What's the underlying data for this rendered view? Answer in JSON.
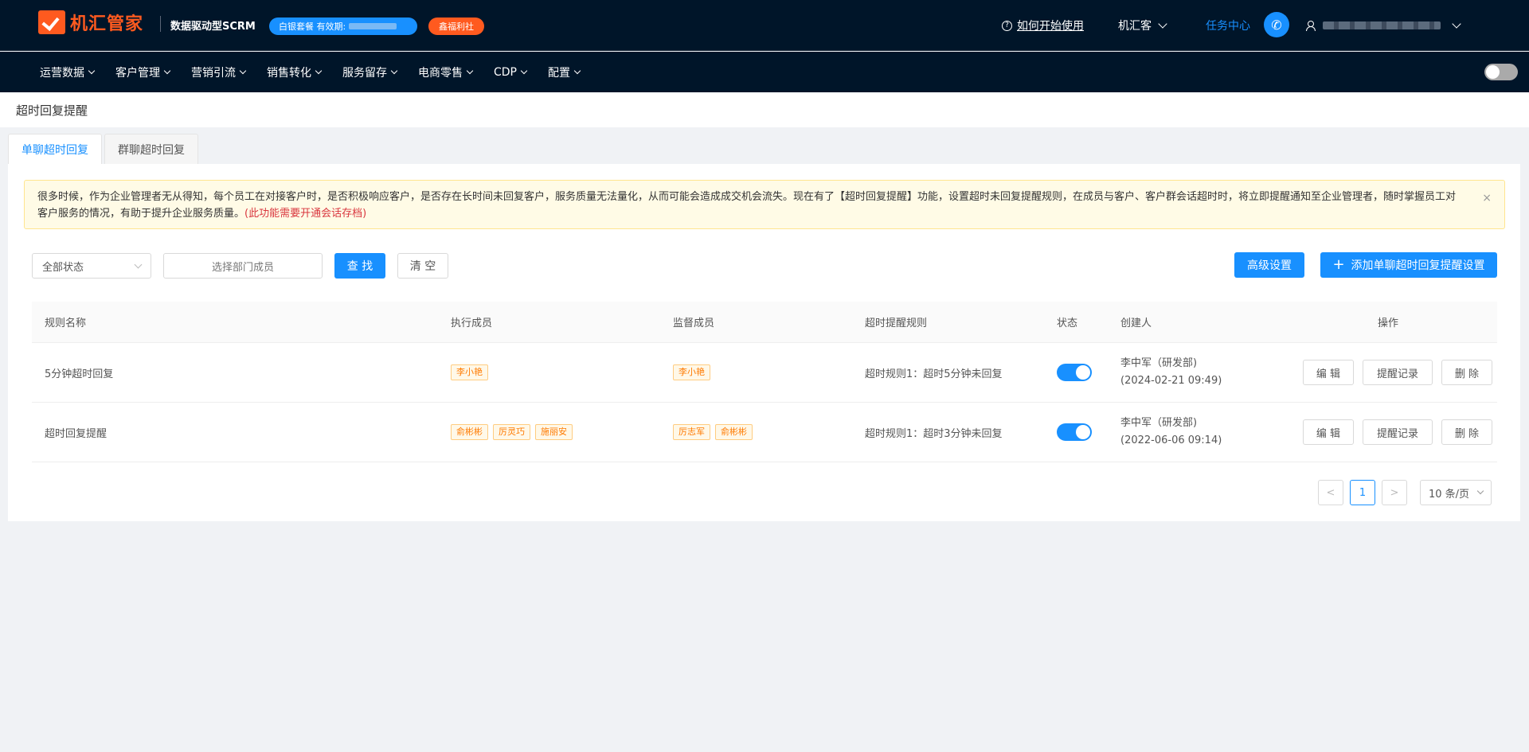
{
  "app": {
    "logo_text": "机汇管家",
    "slogan": "数据驱动型SCRM",
    "package_label": "白银套餐 有效期:",
    "welfare_label": "鑫福利社",
    "help_label": "如何开始使用",
    "org_label": "机汇客",
    "task_center_label": "任务中心"
  },
  "nav": {
    "items": [
      "运营数据",
      "客户管理",
      "营销引流",
      "销售转化",
      "服务留存",
      "电商零售",
      "CDP",
      "配置"
    ]
  },
  "page": {
    "title": "超时回复提醒",
    "tabs": [
      {
        "label": "单聊超时回复",
        "active": true
      },
      {
        "label": "群聊超时回复",
        "active": false
      }
    ]
  },
  "notice": {
    "text": "很多时候，作为企业管理者无从得知，每个员工在对接客户时，是否积极响应客户，是否存在长时间未回复客户，服务质量无法量化，从而可能会造成成交机会流失。现在有了【超时回复提醒】功能，设置超时未回复提醒规则，在成员与客户、客户群会话超时时，将立即提醒通知至企业管理者，随时掌握员工对客户服务的情况，有助于提升企业服务质量。",
    "highlight": "(此功能需要开通会话存档)",
    "close_icon": "×"
  },
  "filters": {
    "status_value": "全部状态",
    "member_placeholder": "选择部门成员",
    "search_label": "查 找",
    "clear_label": "清 空",
    "advanced_label": "高级设置",
    "add_label": "添加单聊超时回复提醒设置"
  },
  "table": {
    "headers": [
      "规则名称",
      "执行成员",
      "监督成员",
      "超时提醒规则",
      "状态",
      "创建人",
      "操作"
    ],
    "rows": [
      {
        "name": "5分钟超时回复",
        "executors": [
          "李小艳"
        ],
        "supervisors": [
          "李小艳"
        ],
        "rule": "超时规则1：超时5分钟未回复",
        "status_on": true,
        "creator": "李中军（研发部)",
        "created_at": "(2024-02-21 09:49)",
        "actions": [
          "编 辑",
          "提醒记录",
          "删 除"
        ]
      },
      {
        "name": "超时回复提醒",
        "executors": [
          "俞彬彬",
          "厉灵巧",
          "施丽安"
        ],
        "supervisors": [
          "厉志军",
          "俞彬彬"
        ],
        "rule": "超时规则1：超时3分钟未回复",
        "status_on": true,
        "creator": "李中军（研发部)",
        "created_at": "(2022-06-06 09:14)",
        "actions": [
          "编 辑",
          "提醒记录",
          "删 除"
        ]
      }
    ]
  },
  "pagination": {
    "current": "1",
    "prev": "<",
    "next": ">",
    "page_size": "10 条/页"
  },
  "colors": {
    "brand": "#ff5a1f",
    "primary": "#1890ff",
    "nav_bg": "#001529"
  }
}
